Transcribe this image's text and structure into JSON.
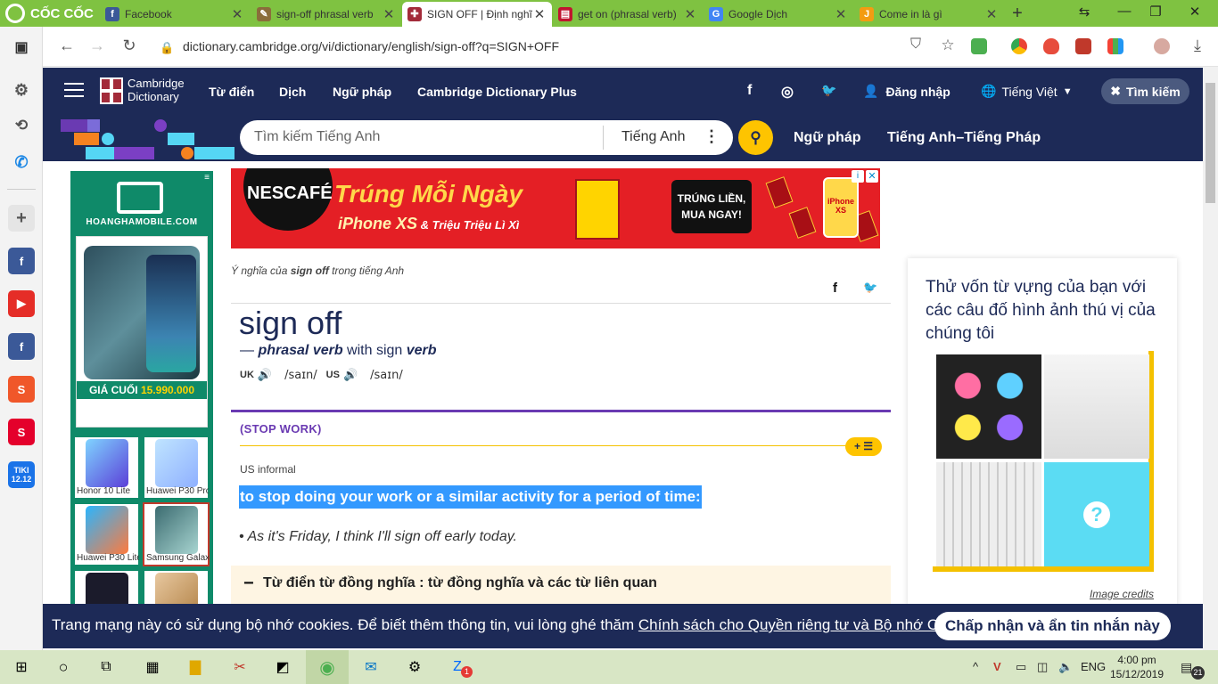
{
  "browser": {
    "brand": "CỐC CỐC",
    "tabs": [
      {
        "title": "Facebook",
        "icon": "facebook-icon",
        "color": "#3b5998",
        "active": false
      },
      {
        "title": "sign-off phrasal verb",
        "icon": "dictionary-icon",
        "color": "#8a6d3b",
        "active": false
      },
      {
        "title": "SIGN OFF | Định nghĩa",
        "icon": "cambridge-crest-icon",
        "color": "#a32b3a",
        "active": true
      },
      {
        "title": "get on (phrasal verb)",
        "icon": "book-icon",
        "color": "#c0152f",
        "active": false
      },
      {
        "title": "Google Dịch",
        "icon": "google-translate-icon",
        "color": "#4285f4",
        "active": false
      },
      {
        "title": "Come in là gì",
        "icon": "j-icon",
        "color": "#f39c12",
        "active": false
      }
    ],
    "url": "dictionary.cambridge.org/vi/dictionary/english/sign-off?q=SIGN+OFF"
  },
  "header": {
    "logo_line1": "Cambridge",
    "logo_line2": "Dictionary",
    "nav": [
      "Từ điển",
      "Dịch",
      "Ngữ pháp",
      "Cambridge Dictionary Plus"
    ],
    "login": "Đăng nhập",
    "language": "Tiếng Việt",
    "search_button": "Tìm kiếm"
  },
  "search": {
    "placeholder": "Tìm kiếm Tiếng Anh",
    "dictionary": "Tiếng Anh",
    "links": [
      "Ngữ pháp",
      "Tiếng Anh–Tiếng Pháp"
    ]
  },
  "ad_left": {
    "brand": "HOANGHAMOBILE.COM",
    "price_label": "GIÁ CUỐI",
    "price": "15.990.000",
    "products": [
      "Honor 10 Lite",
      "Huawei P30 Pro",
      "Huawei P30 Lite",
      "Samsung Galaxy",
      "",
      ""
    ]
  },
  "ad_banner": {
    "brand": "NESCAFÉ",
    "headline": "Trúng Mỗi Ngày",
    "sub_strong": "iPhone XS",
    "sub_rest": " & Triệu Triệu Lì Xì",
    "cta_line1": "TRÚNG LIỀN,",
    "cta_line2": "MUA NGAY!",
    "phone_label": "iPhone XS"
  },
  "entry": {
    "breadcrumb_pre": "Ý nghĩa của ",
    "breadcrumb_word": "sign off",
    "breadcrumb_post": " trong tiếng Anh",
    "headword": "sign off",
    "dash": "— ",
    "pos": "phrasal verb",
    "with": " with sign ",
    "pos2": "verb",
    "uk": "UK",
    "uk_ipa": "/saɪn/",
    "us": "US",
    "us_ipa": "/saɪn/",
    "guideword": "(STOP WORK)",
    "sense_button": "+ ☰",
    "label": "US informal",
    "definition": "to stop doing your work or a similar activity for a period of time:",
    "example": "• As it's Friday, I think I'll sign off early today.",
    "thesaurus": "Từ điển từ đồng nghĩa : từ đồng nghĩa và các từ liên quan"
  },
  "quiz": {
    "title": "Thử vốn từ vựng của bạn với các câu đố hình ảnh thú vị của chúng tôi",
    "credits": "Image credits"
  },
  "cookie": {
    "message": "Trang mạng này có sử dụng bộ nhớ cookies. Để biết thêm thông tin, vui lòng ghé thăm ",
    "link": "Chính sách cho Quyền riêng tư và Bộ nhớ Cookies",
    "end": ".",
    "accept": "Chấp nhận và ẩn tin nhắn này"
  },
  "taskbar": {
    "language": "ENG",
    "time": "4:00 pm",
    "date": "15/12/2019",
    "notifications": "21",
    "zalo_badge": "1"
  },
  "colors": {
    "cambridge_navy": "#1d2a57",
    "accent_yellow": "#fec400",
    "highlight_blue": "#3399ff",
    "guideword_purple": "#6a3ab2",
    "browser_green": "#7fc241"
  }
}
